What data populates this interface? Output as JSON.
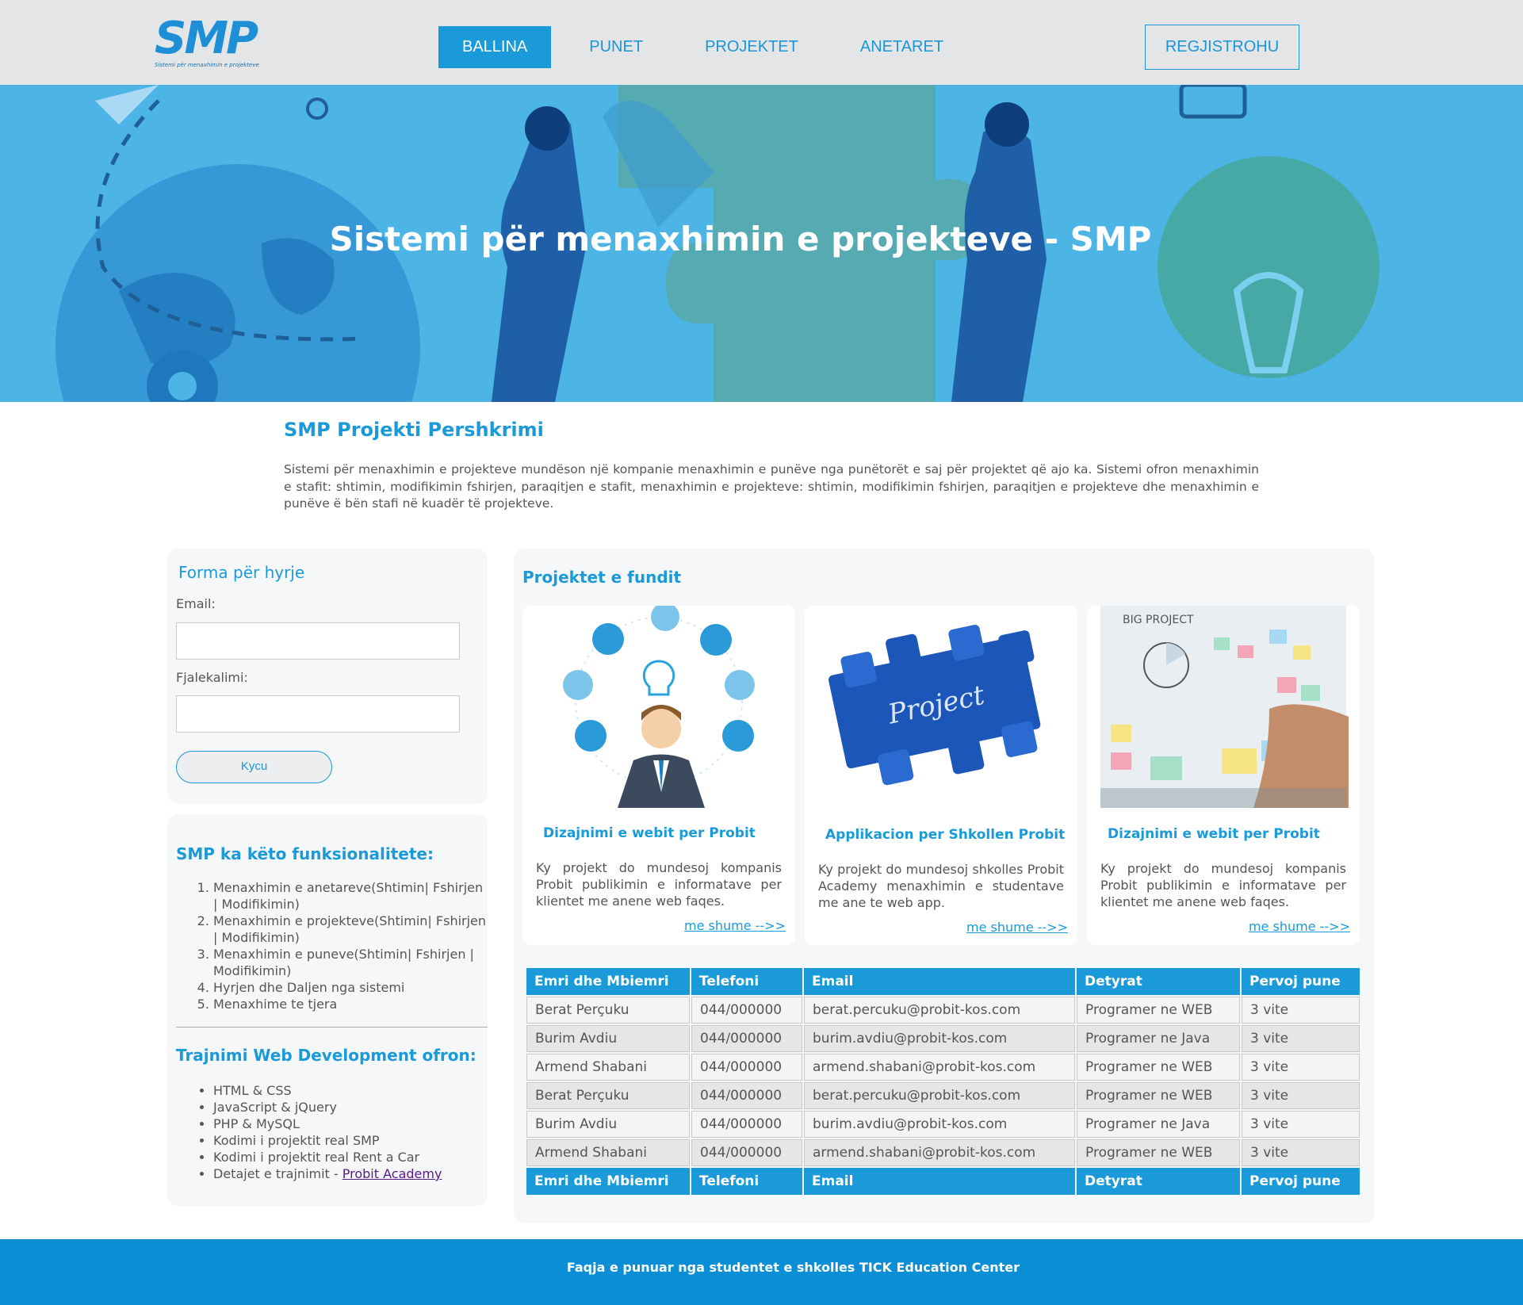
{
  "header": {
    "logo_text": "SMP",
    "logo_subtitle": "Sistemi për menaxhimin e projekteve",
    "nav": [
      {
        "label": "BALLINA",
        "active": true
      },
      {
        "label": "PUNET",
        "active": false
      },
      {
        "label": "PROJEKTET",
        "active": false
      },
      {
        "label": "ANETARET",
        "active": false
      }
    ],
    "register_label": "REGJISTROHU"
  },
  "hero": {
    "title": "Sistemi për menaxhimin e projekteve - SMP"
  },
  "intro": {
    "title": "SMP Projekti Pershkrimi",
    "text": "Sistemi për menaxhimin e projekteve mundëson një kompanie menaxhimin e punëve nga punëtorët e saj për projektet që ajo ka. Sistemi ofron menaxhimin e stafit: shtimin, modifikimin fshirjen, paraqitjen e stafit, menaxhimin e projekteve: shtimin, modifikimin fshirjen, paraqitjen e projekteve dhe menaxhimin e punëve ë bën stafi në kuadër të projekteve."
  },
  "login": {
    "title": "Forma për hyrje",
    "email_label": "Email:",
    "email_value": "",
    "password_label": "Fjalekalimi:",
    "password_value": "",
    "submit_label": "Kycu"
  },
  "features": {
    "title": "SMP ka këto funksionalitete:",
    "items": [
      "Menaxhimin e anetareve(Shtimin| Fshirjen | Modifikimin)",
      "Menaxhimin e projekteve(Shtimin| Fshirjen | Modifikimin)",
      "Menaxhimin e puneve(Shtimin| Fshirjen | Modifikimin)",
      "Hyrjen dhe Daljen nga sistemi",
      "Menaxhime te tjera"
    ]
  },
  "training": {
    "title": "Trajnimi Web Development ofron:",
    "items": [
      "HTML & CSS",
      "JavaScript & jQuery",
      "PHP & MySQL",
      "Kodimi i projektit real SMP",
      "Kodimi i projektit real Rent a Car"
    ],
    "last_item_prefix": "Detajet e trajnimit - ",
    "last_item_link": "Probit Academy"
  },
  "projects": {
    "title": "Projektet e fundit",
    "cards": [
      {
        "title": "Dizajnimi e webit per Probit",
        "text": "Ky projekt do mundesoj kompanis Probit publikimin e informatave per klientet me anene web faqes.",
        "link": "me shume -->>",
        "image": "businessman-icons-illustration"
      },
      {
        "title": "Applikacion per Shkollen Probit",
        "text": "Ky projekt do mundesoj shkolles Probit Academy menaxhimin e studentave me ane te web app.",
        "link": "me shume -->>",
        "image": "project-puzzle-illustration",
        "image_caption": "Project"
      },
      {
        "title": "Dizajnimi e webit per Probit",
        "text": "Ky projekt do mundesoj kompanis Probit publikimin e informatave per klientet me anene web faqes.",
        "link": "me shume -->>",
        "image": "big-project-whiteboard-photo",
        "image_caption": "BIG PROJECT"
      }
    ]
  },
  "table": {
    "headers": [
      "Emri dhe Mbiemri",
      "Telefoni",
      "Email",
      "Detyrat",
      "Pervoj pune"
    ],
    "rows": [
      [
        "Berat Perçuku",
        "044/000000",
        "berat.percuku@probit-kos.com",
        "Programer ne WEB",
        "3 vite"
      ],
      [
        "Burim Avdiu",
        "044/000000",
        "burim.avdiu@probit-kos.com",
        "Programer ne Java",
        "3 vite"
      ],
      [
        "Armend Shabani",
        "044/000000",
        "armend.shabani@probit-kos.com",
        "Programer ne WEB",
        "3 vite"
      ],
      [
        "Berat Perçuku",
        "044/000000",
        "berat.percuku@probit-kos.com",
        "Programer ne WEB",
        "3 vite"
      ],
      [
        "Burim Avdiu",
        "044/000000",
        "burim.avdiu@probit-kos.com",
        "Programer ne Java",
        "3 vite"
      ],
      [
        "Armend Shabani",
        "044/000000",
        "armend.shabani@probit-kos.com",
        "Programer ne WEB",
        "3 vite"
      ]
    ]
  },
  "footer": {
    "text": "Faqja e punuar nga studentet e shkolles TICK Education Center"
  },
  "colors": {
    "accent": "#1b9ad9",
    "header_bg": "#e4e5e6",
    "hero_bg": "#4db4e6",
    "footer_bg": "#0a8fd6"
  }
}
